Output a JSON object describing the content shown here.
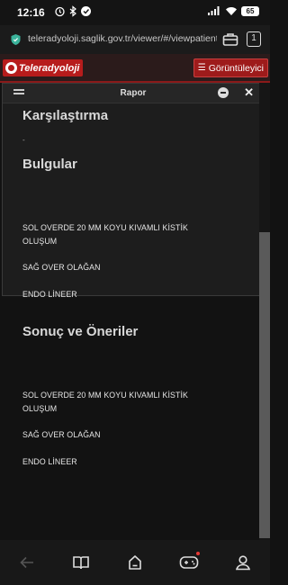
{
  "status_bar": {
    "time": "12:16",
    "battery": "65"
  },
  "browser": {
    "url": "teleradyoloji.saglik.gov.tr/viewer/#/viewpatient?otac",
    "tab_count": "1"
  },
  "site": {
    "logo_text": "Teleradyoloji",
    "viewer_button_label": "Görüntüleyici"
  },
  "dialog": {
    "title": "Rapor"
  },
  "report": {
    "comparison_heading": "Karşılaştırma",
    "comparison_value": "-",
    "findings_heading": "Bulgular",
    "findings": [
      "SOL OVERDE 20 MM KOYU KIVAMLI KİSTİK",
      "OLUŞUM",
      "SAĞ OVER OLAĞAN",
      "ENDO LİNEER"
    ],
    "conclusion_heading": "Sonuç ve Öneriler",
    "conclusions": [
      "SOL OVERDE 20 MM KOYU KIVAMLI KİSTİK",
      "OLUŞUM",
      "SAĞ OVER OLAĞAN",
      "ENDO LİNEER"
    ]
  },
  "colors": {
    "brand_red": "#b71c1c",
    "background": "#121212"
  },
  "bottom_nav": {
    "icons": [
      "back-icon",
      "book-icon",
      "home-icon",
      "game-icon",
      "profile-icon"
    ],
    "game_has_notification": true
  }
}
